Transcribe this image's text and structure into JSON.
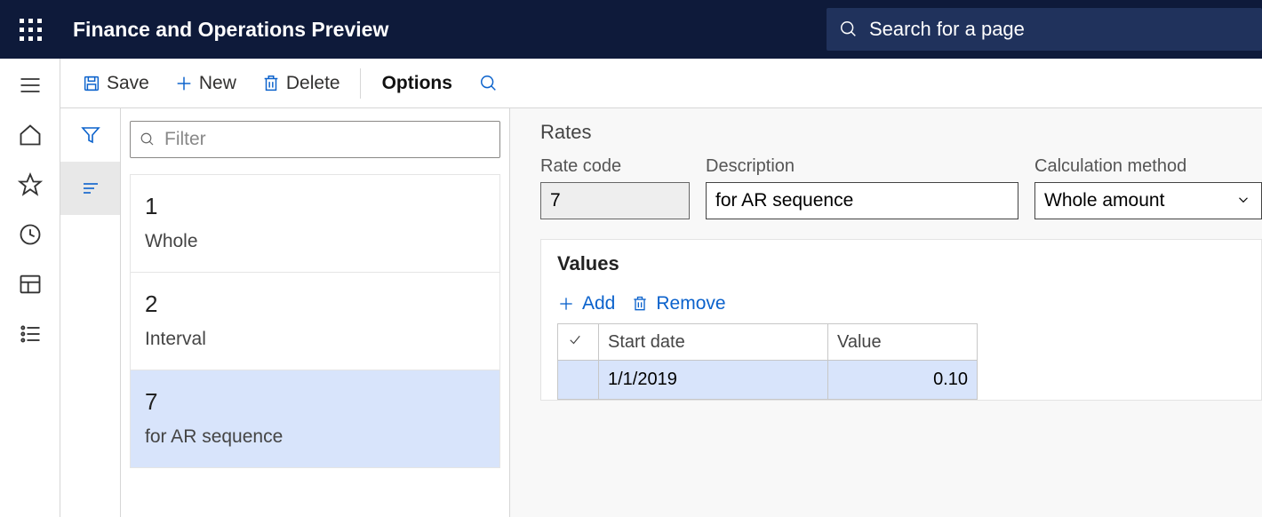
{
  "header": {
    "app_title": "Finance and Operations Preview",
    "search_placeholder": "Search for a page"
  },
  "toolbar": {
    "save": "Save",
    "new": "New",
    "delete": "Delete",
    "options": "Options"
  },
  "list": {
    "filter_placeholder": "Filter",
    "items": [
      {
        "code": "1",
        "desc": "Whole"
      },
      {
        "code": "2",
        "desc": "Interval"
      },
      {
        "code": "7",
        "desc": "for AR sequence"
      }
    ],
    "selected_index": 2
  },
  "detail": {
    "section_title": "Rates",
    "fields": {
      "rate_code_label": "Rate code",
      "rate_code_value": "7",
      "description_label": "Description",
      "description_value": "for AR sequence",
      "calc_method_label": "Calculation method",
      "calc_method_value": "Whole amount"
    },
    "values": {
      "title": "Values",
      "add_label": "Add",
      "remove_label": "Remove",
      "columns": {
        "start_date": "Start date",
        "value": "Value"
      },
      "rows": [
        {
          "start_date": "1/1/2019",
          "value": "0.10"
        }
      ]
    }
  }
}
